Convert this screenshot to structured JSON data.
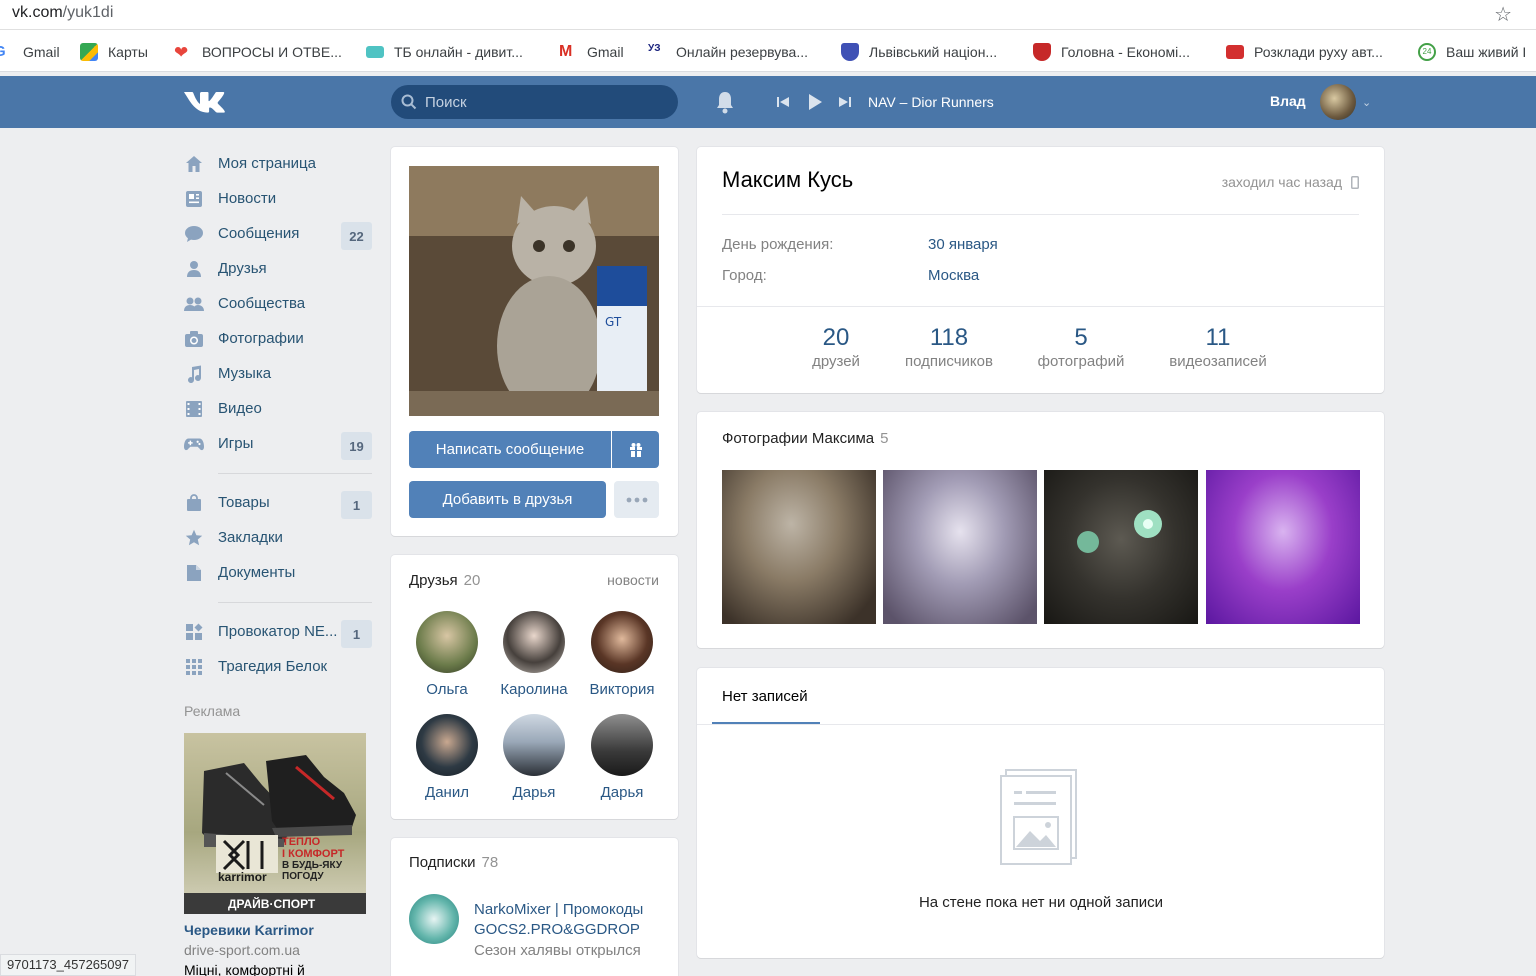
{
  "browser": {
    "url_host": "vk.com",
    "url_path": "/yuk1di",
    "bookmarks": [
      {
        "label": "Gmail",
        "icon": "google-icon",
        "color": "#4285f4"
      },
      {
        "label": "Карты",
        "icon": "maps-icon",
        "color": "#34a853"
      },
      {
        "label": "ВОПРОСЫ И ОТВЕ...",
        "icon": "heart-icon",
        "color": "#e8453c"
      },
      {
        "label": "ТБ онлайн - дивит...",
        "icon": "tv-icon",
        "color": "#4fc3c3"
      },
      {
        "label": "Gmail",
        "icon": "gmail-icon",
        "color": "#d93025"
      },
      {
        "label": "Онлайн резервува...",
        "icon": "uz-icon",
        "color": "#1a237e"
      },
      {
        "label": "Львівський націон...",
        "icon": "crest-icon",
        "color": "#3f51b5"
      },
      {
        "label": "Головна - Економі...",
        "icon": "crest-icon",
        "color": "#c62828"
      },
      {
        "label": "Розклади руху авт...",
        "icon": "bus-icon",
        "color": "#d32f2f"
      },
      {
        "label": "Ваш живий І",
        "icon": "24-icon",
        "color": "#43a047"
      }
    ],
    "status_text": "9701173_457265097"
  },
  "header": {
    "search_placeholder": "Поиск",
    "track": "NAV – Dior Runners",
    "user_name": "Влад"
  },
  "menu": {
    "group1": [
      {
        "label": "Моя страница",
        "icon": "home-icon",
        "badge": ""
      },
      {
        "label": "Новости",
        "icon": "news-icon",
        "badge": ""
      },
      {
        "label": "Сообщения",
        "icon": "messages-icon",
        "badge": "22"
      },
      {
        "label": "Друзья",
        "icon": "friend-icon",
        "badge": ""
      },
      {
        "label": "Сообщества",
        "icon": "groups-icon",
        "badge": ""
      },
      {
        "label": "Фотографии",
        "icon": "camera-icon",
        "badge": ""
      },
      {
        "label": "Музыка",
        "icon": "music-icon",
        "badge": ""
      },
      {
        "label": "Видео",
        "icon": "video-icon",
        "badge": ""
      },
      {
        "label": "Игры",
        "icon": "gamepad-icon",
        "badge": "19"
      }
    ],
    "group2": [
      {
        "label": "Товары",
        "icon": "bag-icon",
        "badge": "1"
      },
      {
        "label": "Закладки",
        "icon": "star-icon",
        "badge": ""
      },
      {
        "label": "Документы",
        "icon": "document-icon",
        "badge": ""
      }
    ],
    "group3": [
      {
        "label": "Провокатор NE...",
        "icon": "app-icon",
        "badge": "1"
      },
      {
        "label": "Трагедия Белок",
        "icon": "apps-grid-icon",
        "badge": ""
      }
    ],
    "ad_label": "Реклама",
    "ad": {
      "brand": "karrimor",
      "slogan": [
        "ТЕПЛО",
        "І КОМФОРТ",
        "В БУДЬ-ЯКУ",
        "ПОГОДУ"
      ],
      "shop": "ДРАЙВ·СПОРТ",
      "title": "Черевики Karrimor",
      "domain": "drive-sport.com.ua",
      "text": "Міцні, комфортні й"
    }
  },
  "profile": {
    "send_message": "Написать сообщение",
    "add_friend": "Добавить в друзья",
    "name": "Максим Кусь",
    "last_seen": "заходил час назад",
    "birthday_label": "День рождения:",
    "birthday": "30 января",
    "city_label": "Город:",
    "city": "Москва",
    "stats": [
      {
        "num": "20",
        "label": "друзей"
      },
      {
        "num": "118",
        "label": "подписчиков"
      },
      {
        "num": "5",
        "label": "фотографий"
      },
      {
        "num": "11",
        "label": "видеозаписей"
      }
    ]
  },
  "friends": {
    "title": "Друзья",
    "count": "20",
    "news_link": "новости",
    "items": [
      {
        "name": "Ольга"
      },
      {
        "name": "Каролина"
      },
      {
        "name": "Виктория"
      },
      {
        "name": "Данил"
      },
      {
        "name": "Дарья"
      },
      {
        "name": "Дарья"
      }
    ]
  },
  "subscriptions": {
    "title": "Подписки",
    "count": "78",
    "item_name": "NarkoMixer | Промокоды GOCS2.PRO&GGDROP",
    "item_desc": "Сезон халявы открылся"
  },
  "photos": {
    "title": "Фотографии Максима",
    "count": "5"
  },
  "wall": {
    "tab": "Нет записей",
    "empty": "На стене пока нет ни одной записи"
  }
}
